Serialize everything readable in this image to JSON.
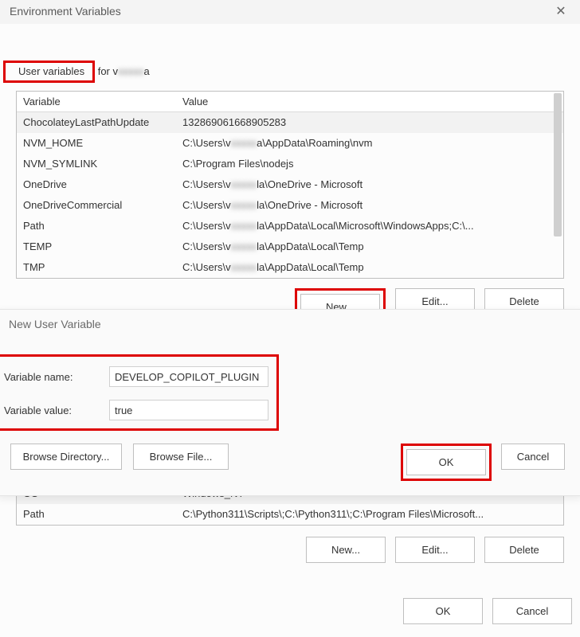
{
  "main_dialog": {
    "title": "Environment Variables",
    "close_glyph": "✕",
    "user_section_prefix": "User variables",
    "user_section_suffix_left": " for v",
    "user_section_suffix_blur": "xxxxx",
    "user_section_suffix_right": "a",
    "headers": {
      "var": "Variable",
      "val": "Value"
    },
    "user_rows": [
      {
        "var": "ChocolateyLastPathUpdate",
        "val": "132869061668905283"
      },
      {
        "var": "NVM_HOME",
        "val_pre": "C:\\Users\\v",
        "val_blur": "xxxxx",
        "val_post": "a\\AppData\\Roaming\\nvm"
      },
      {
        "var": "NVM_SYMLINK",
        "val": "C:\\Program Files\\nodejs"
      },
      {
        "var": "OneDrive",
        "val_pre": "C:\\Users\\v",
        "val_blur": "xxxxx",
        "val_post": "la\\OneDrive - Microsoft"
      },
      {
        "var": "OneDriveCommercial",
        "val_pre": "C:\\Users\\v",
        "val_blur": "xxxxx",
        "val_post": "la\\OneDrive - Microsoft"
      },
      {
        "var": "Path",
        "val_pre": "C:\\Users\\v",
        "val_blur": "xxxxx",
        "val_post": "la\\AppData\\Local\\Microsoft\\WindowsApps;C:\\..."
      },
      {
        "var": "TEMP",
        "val_pre": "C:\\Users\\v",
        "val_blur": "xxxxx",
        "val_post": "la\\AppData\\Local\\Temp"
      },
      {
        "var": "TMP",
        "val_pre": "C:\\Users\\v",
        "val_blur": "xxxxx",
        "val_post": "la\\AppData\\Local\\Temp"
      }
    ],
    "user_buttons": {
      "new": "New...",
      "edit": "Edit...",
      "delete": "Delete"
    },
    "sys_rows_visible": [
      {
        "var": "OS",
        "val": "Windows_NT"
      },
      {
        "var": "Path",
        "val": "C:\\Python311\\Scripts\\;C:\\Python311\\;C:\\Program Files\\Microsoft..."
      }
    ],
    "sys_buttons": {
      "new": "New...",
      "edit": "Edit...",
      "delete": "Delete"
    },
    "bottom_buttons": {
      "ok": "OK",
      "cancel": "Cancel"
    }
  },
  "sub_dialog": {
    "title": "New User Variable",
    "name_label": "Variable name:",
    "value_label": "Variable value:",
    "name_value": "DEVELOP_COPILOT_PLUGIN",
    "value_value": "true",
    "buttons": {
      "browse_dir": "Browse Directory...",
      "browse_file": "Browse File...",
      "ok": "OK",
      "cancel": "Cancel"
    }
  }
}
